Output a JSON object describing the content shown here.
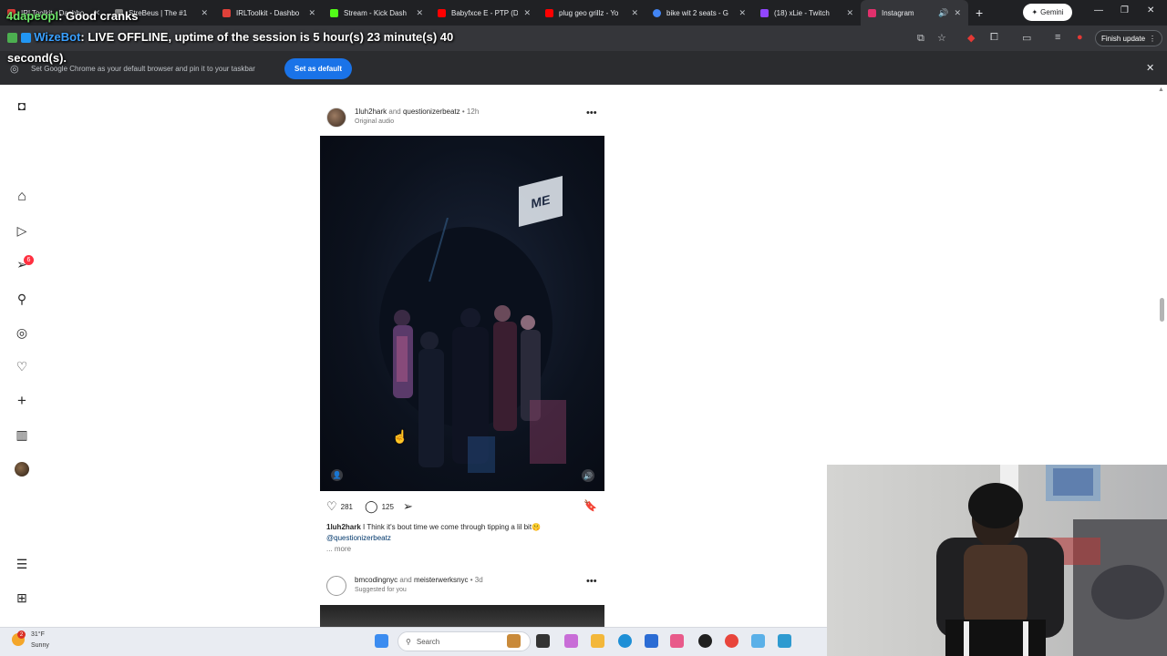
{
  "browser": {
    "tabs": [
      {
        "title": "IRLToolkit - Dashbo",
        "color": "#e0413a"
      },
      {
        "title": "StreBeus | The #1",
        "color": "#8a8a8a"
      },
      {
        "title": "IRLToolkit - Dashbo",
        "color": "#e0413a"
      },
      {
        "title": "Stream - Kick Dash",
        "color": "#53fc18"
      },
      {
        "title": "Babyfxce E - PTP (D",
        "color": "#ff0000"
      },
      {
        "title": "plug geo grillz - Yo",
        "color": "#ff0000"
      },
      {
        "title": "bike wit 2 seats - G",
        "color": "#4285f4"
      },
      {
        "title": "(18) xLie - Twitch",
        "color": "#9146ff"
      },
      {
        "title": "Instagram",
        "color": "#e1306c"
      }
    ],
    "gemini_label": "Gemini",
    "finish_update_label": "Finish update",
    "infobar_text": "Set Google Chrome as your default browser and pin it to your taskbar",
    "set_default_label": "Set as default"
  },
  "overlay": {
    "chat_user": "4dapeopl",
    "chat_message": ": Good cranks",
    "bot_name": "WizeBot",
    "bot_message": ":  LIVE OFFLINE, uptime of the session is 5 hour(s) 23 minute(s) 40",
    "bot_message_cont": "second(s)."
  },
  "sidebar": {
    "notification_count": "6",
    "icons": [
      "instagram-icon",
      "home-icon",
      "reels-icon",
      "messages-icon",
      "search-icon",
      "explore-icon",
      "notifications-icon",
      "create-icon",
      "dashboard-icon",
      "profile-avatar",
      "more-menu-icon",
      "also-from-meta-icon"
    ]
  },
  "posts": [
    {
      "user1": "1luh2hark",
      "joiner": " and ",
      "user2": "questionizerbeatz",
      "time": "• 12h",
      "subtitle": "Original audio",
      "likes": "281",
      "comments": "125",
      "caption_user": "1luh2hark",
      "caption_text": " I Think it's bout time we come through tipping a lil bit🤫",
      "caption_mention": "@questionizerbeatz",
      "caption_more": "... more"
    },
    {
      "user1": "bmcodingnyc",
      "joiner": " and ",
      "user2": "meisterwerksnyc",
      "time": "• 3d",
      "subtitle": "Suggested for you"
    }
  ],
  "taskbar": {
    "weather_temp": "31°F",
    "weather_cond": "Sunny",
    "weather_badge": "2",
    "search_placeholder": "Search"
  }
}
